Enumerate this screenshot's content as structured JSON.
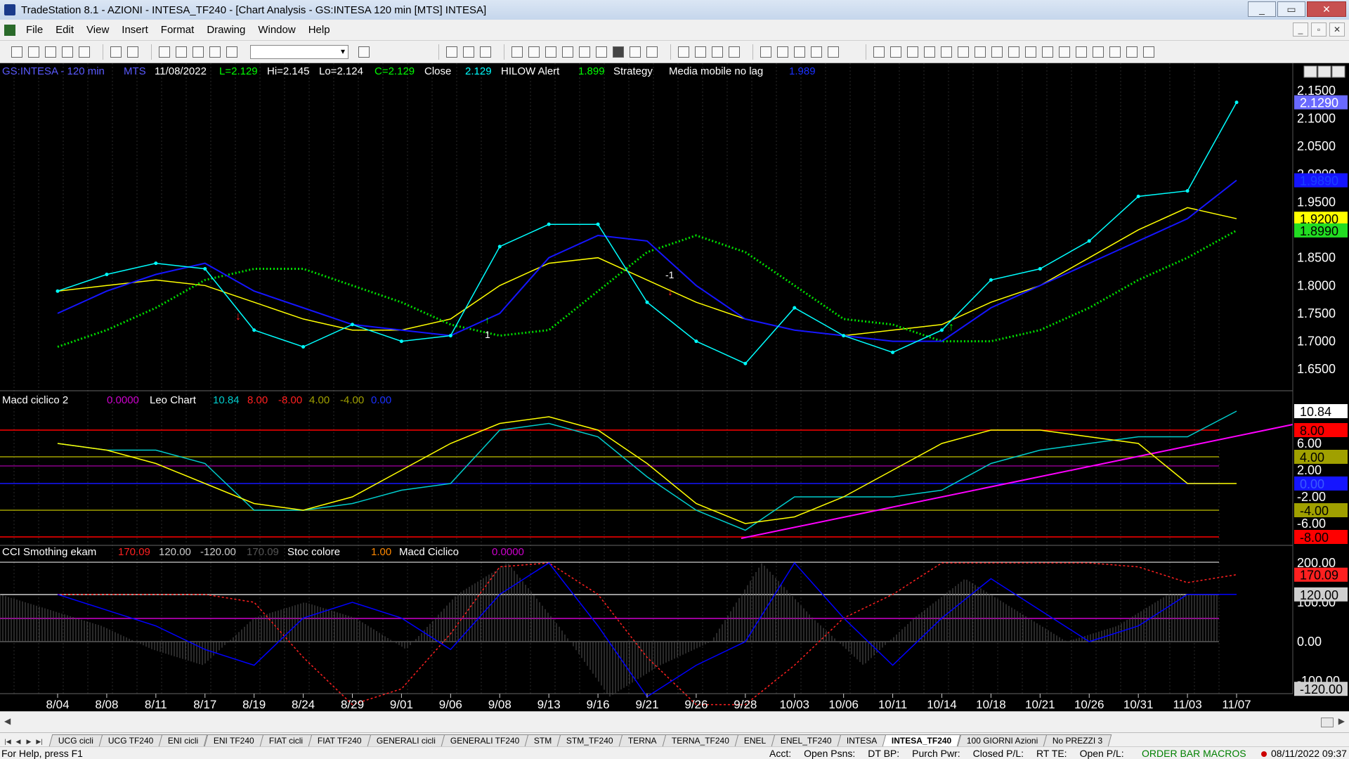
{
  "window": {
    "title": "TradeStation 8.1 - AZIONI - INTESA_TF240 - [Chart Analysis - GS:INTESA  120 min  [MTS] INTESA]",
    "minimize": "_",
    "maximize": "▭",
    "close": "✕"
  },
  "menu": [
    "File",
    "Edit",
    "View",
    "Insert",
    "Format",
    "Drawing",
    "Window",
    "Help"
  ],
  "doc_buttons": [
    "_",
    "▫",
    "✕"
  ],
  "price_header": {
    "symbol": "GS:INTESA - 120 min",
    "source": "MTS",
    "date": "11/08/2022",
    "low_label": "L=2.129",
    "high_label": "Hi=2.145",
    "lo_label": "Lo=2.124",
    "close_label": "C=2.129",
    "close_name": "Close",
    "close_value": "2.129",
    "hilow_name": "HILOW Alert",
    "hilow_value": "1.899",
    "strategy_name": "Strategy",
    "media_name": "Media mobile no lag",
    "media_value": "1.989"
  },
  "macd_header": {
    "name": "Macd ciclico 2",
    "v1": "0.0000",
    "leo": "Leo Chart",
    "v2": "10.84",
    "v3": "8.00",
    "v4": "-8.00",
    "v5": "4.00",
    "v6": "-4.00",
    "v7": "0.00"
  },
  "cci_header": {
    "name": "CCI Smothing ekam",
    "v1": "170.09",
    "v2": "120.00",
    "v3": "-120.00",
    "v4": "170.09",
    "stoc": "Stoc colore",
    "v5": "1.00",
    "macd": "Macd Ciclico",
    "v6": "0.0000"
  },
  "price_axis": {
    "ticks": [
      "2.1500",
      "2.1000",
      "2.0500",
      "2.0000",
      "1.9500",
      "1.9000",
      "1.8500",
      "1.8000",
      "1.7500",
      "1.7000",
      "1.6500"
    ],
    "tags": [
      {
        "text": "2.1290",
        "bg": "#6a6aff",
        "fg": "#ffffff"
      },
      {
        "text": "1.9890",
        "bg": "#1515ff",
        "fg": "#1a40ff"
      },
      {
        "text": "1.9200",
        "bg": "#ffff00",
        "fg": "#000000"
      },
      {
        "text": "1.8990",
        "bg": "#22dd22",
        "fg": "#000000"
      }
    ]
  },
  "macd_axis": {
    "ticks": [
      "6.00",
      "2.00",
      "-2.00",
      "-6.00"
    ],
    "tags": [
      {
        "text": "10.84",
        "bg": "#ffffff",
        "fg": "#000000"
      },
      {
        "text": "8.00",
        "bg": "#ff0000",
        "fg": "#000000"
      },
      {
        "text": "4.00",
        "bg": "#a0a000",
        "fg": "#000000"
      },
      {
        "text": "0.00",
        "bg": "#1515ff",
        "fg": "#3a5aff"
      },
      {
        "text": "-4.00",
        "bg": "#a0a000",
        "fg": "#000000"
      },
      {
        "text": "-8.00",
        "bg": "#ff0000",
        "fg": "#000000"
      }
    ]
  },
  "cci_axis": {
    "ticks": [
      "200.00",
      "100.00",
      "0.00",
      "-100.00"
    ],
    "tags": [
      {
        "text": "170.09",
        "bg": "#ff2020",
        "fg": "#000000"
      },
      {
        "text": "120.00",
        "bg": "#cfcfcf",
        "fg": "#000000"
      },
      {
        "text": "-120.00",
        "bg": "#cfcfcf",
        "fg": "#000000"
      }
    ]
  },
  "date_axis": [
    "8/04",
    "8/08",
    "8/11",
    "8/17",
    "8/19",
    "8/24",
    "8/29",
    "9/01",
    "9/06",
    "9/08",
    "9/13",
    "9/16",
    "9/21",
    "9/26",
    "9/28",
    "10/03",
    "10/06",
    "10/11",
    "10/14",
    "10/18",
    "10/21",
    "10/26",
    "10/31",
    "11/03",
    "11/07"
  ],
  "signals": {
    "buy1": "1",
    "sell1": "-1"
  },
  "tabs": [
    "UCG cicli",
    "UCG TF240",
    "ENI cicli",
    "ENI TF240",
    "FIAT cicli",
    "FIAT TF240",
    "GENERALI cicli",
    "GENERALI TF240",
    "STM",
    "STM_TF240",
    "TERNA",
    "TERNA_TF240",
    "ENEL",
    "ENEL_TF240",
    "INTESA",
    "INTESA_TF240",
    "100 GIORNI Azioni",
    "No PREZZI 3"
  ],
  "active_tab": "INTESA_TF240",
  "status": {
    "help": "For Help, press F1",
    "acct": "Acct:",
    "open_psns": "Open Psns:",
    "dt_bp": "DT BP:",
    "purch_pwr": "Purch Pwr:",
    "closed_pl": "Closed P/L:",
    "rt_te": "RT TE:",
    "open_pl": "Open P/L:",
    "order_bar": "ORDER BAR  MACROS",
    "clock": "08/11/2022 09:37"
  },
  "chart_data": {
    "type": "line",
    "title": "GS:INTESA - 120 min",
    "categories": [
      "8/04",
      "8/08",
      "8/11",
      "8/17",
      "8/19",
      "8/24",
      "8/29",
      "9/01",
      "9/06",
      "9/08",
      "9/13",
      "9/16",
      "9/21",
      "9/26",
      "9/28",
      "10/03",
      "10/06",
      "10/11",
      "10/14",
      "10/18",
      "10/21",
      "10/26",
      "10/31",
      "11/03",
      "11/07"
    ],
    "ylim": [
      1.625,
      2.155
    ],
    "series": [
      {
        "name": "Close",
        "color": "#00ffff",
        "values": [
          1.79,
          1.82,
          1.84,
          1.83,
          1.72,
          1.69,
          1.73,
          1.7,
          1.71,
          1.87,
          1.91,
          1.91,
          1.77,
          1.7,
          1.66,
          1.76,
          1.71,
          1.68,
          1.72,
          1.81,
          1.83,
          1.88,
          1.96,
          1.97,
          2.129
        ]
      },
      {
        "name": "Media mobile no lag",
        "color": "#1515ff",
        "values": [
          1.75,
          1.79,
          1.82,
          1.84,
          1.79,
          1.76,
          1.73,
          1.72,
          1.71,
          1.75,
          1.85,
          1.89,
          1.88,
          1.8,
          1.74,
          1.72,
          1.71,
          1.7,
          1.7,
          1.76,
          1.8,
          1.84,
          1.88,
          1.92,
          1.989
        ]
      },
      {
        "name": "HILOW Alert",
        "color": "#00dd00",
        "values": [
          1.69,
          1.72,
          1.76,
          1.81,
          1.83,
          1.83,
          1.8,
          1.77,
          1.73,
          1.71,
          1.72,
          1.79,
          1.86,
          1.89,
          1.86,
          1.8,
          1.74,
          1.73,
          1.7,
          1.7,
          1.72,
          1.76,
          1.81,
          1.85,
          1.899
        ]
      },
      {
        "name": "Close",
        "color": "#ffff00",
        "values": [
          1.79,
          1.8,
          1.81,
          1.8,
          1.77,
          1.74,
          1.72,
          1.72,
          1.74,
          1.8,
          1.84,
          1.85,
          1.81,
          1.77,
          1.74,
          1.72,
          1.71,
          1.72,
          1.73,
          1.77,
          1.8,
          1.85,
          1.9,
          1.94,
          1.92
        ]
      }
    ],
    "macd_series": [
      {
        "name": "Macd ciclico 2",
        "color": "#00cccc",
        "values": [
          6,
          5,
          5,
          3,
          -4,
          -4,
          -3,
          -1,
          0,
          8,
          9,
          7,
          1,
          -4,
          -7,
          -2,
          -2,
          -2,
          -1,
          3,
          5,
          6,
          7,
          7,
          10.84
        ]
      },
      {
        "name": "Leo Chart",
        "color": "#ffff00",
        "values": [
          6,
          5,
          3,
          0,
          -3,
          -4,
          -2,
          2,
          6,
          9,
          10,
          8,
          3,
          -3,
          -6,
          -5,
          -2,
          2,
          6,
          8,
          8,
          7,
          6,
          0,
          0
        ]
      }
    ],
    "cci_series": [
      {
        "name": "CCI Smothing ekam",
        "color": "#ff2020",
        "values": [
          120,
          120,
          120,
          120,
          100,
          -40,
          -160,
          -120,
          20,
          190,
          200,
          120,
          -40,
          -160,
          -160,
          -60,
          60,
          120,
          200,
          200,
          200,
          200,
          190,
          150,
          170.09
        ]
      },
      {
        "name": "Stoc colore",
        "color": "#0000ff",
        "values": [
          120,
          80,
          40,
          -20,
          -60,
          60,
          100,
          60,
          -20,
          120,
          200,
          40,
          -140,
          -60,
          0,
          200,
          60,
          -60,
          60,
          160,
          80,
          0,
          40,
          120,
          120
        ]
      }
    ]
  }
}
